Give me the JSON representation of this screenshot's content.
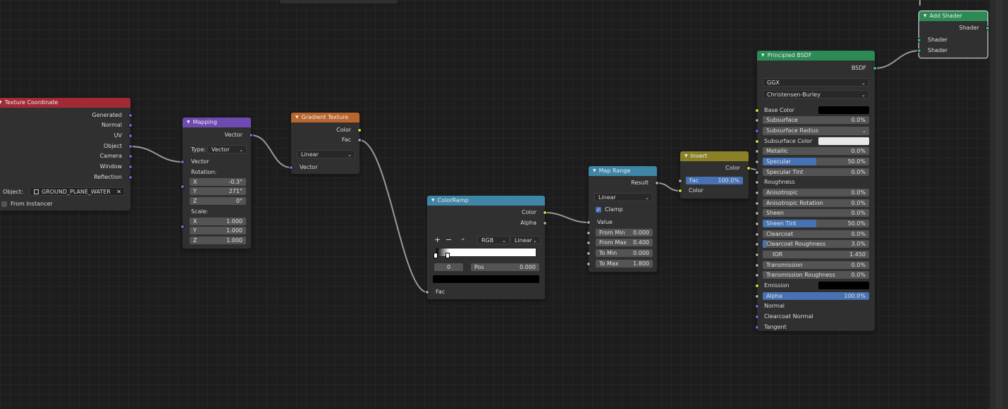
{
  "colors": {
    "texcoord_header": "#a22a35",
    "mapping_header": "#6e4bb0",
    "texture_header": "#b8652e",
    "converter_header": "#3e85a6",
    "color_header": "#8a8127",
    "shader_header": "#2c8a55",
    "vector_socket": "#6c69d2",
    "color_socket": "#d8d83a",
    "float_socket": "#a3a3a3",
    "shader_socket": "#38c06f",
    "value_bar": "#4772b3"
  },
  "texcoord": {
    "title": "Texture Coordinate",
    "outputs": [
      "Generated",
      "Normal",
      "UV",
      "Object",
      "Camera",
      "Window",
      "Reflection"
    ],
    "object_label": "Object:",
    "object_value": "GROUND_PLANE_WATER",
    "from_instancer": "From Instancer",
    "object_icon": "cube-icon",
    "clear_icon": "close-icon"
  },
  "mapping": {
    "title": "Mapping",
    "output": "Vector",
    "type_label": "Type:",
    "type_value": "Vector",
    "vector_label": "Vector",
    "rotation_label": "Rotation:",
    "rotation": [
      {
        "axis": "X",
        "value": "-0.3°"
      },
      {
        "axis": "Y",
        "value": "271°"
      },
      {
        "axis": "Z",
        "value": "0°"
      }
    ],
    "scale_label": "Scale:",
    "scale": [
      {
        "axis": "X",
        "value": "1.000"
      },
      {
        "axis": "Y",
        "value": "1.000"
      },
      {
        "axis": "Z",
        "value": "1.000"
      }
    ]
  },
  "gradient": {
    "title": "Gradient Texture",
    "outputs": [
      "Color",
      "Fac"
    ],
    "type_value": "Linear",
    "input": "Vector"
  },
  "colorramp": {
    "title": "ColorRamp",
    "outputs": [
      "Color",
      "Alpha"
    ],
    "add": "+",
    "remove": "−",
    "menu": "⌄",
    "mode": "RGB",
    "interp": "Linear",
    "index": "0",
    "pos_label": "Pos",
    "pos_value": "0.000",
    "input": "Fac"
  },
  "maprange": {
    "title": "Map Range",
    "output": "Result",
    "interp": "Linear",
    "clamp": "Clamp",
    "clamp_checked": true,
    "value_label": "Value",
    "fields": [
      {
        "label": "From Min",
        "value": "0.000"
      },
      {
        "label": "From Max",
        "value": "0.400"
      },
      {
        "label": "To Min",
        "value": "0.000"
      },
      {
        "label": "To Max",
        "value": "1.800"
      }
    ]
  },
  "invert": {
    "title": "Invert",
    "output": "Color",
    "fac_label": "Fac",
    "fac_value": "100.0%",
    "fac_level": 1.0,
    "color_label": "Color"
  },
  "principled": {
    "title": "Principled BSDF",
    "output": "BSDF",
    "distribution": "GGX",
    "subsurface_method": "Christensen-Burley",
    "base_color": "#000000",
    "subsurface_color": "#e8e8e8",
    "emission": "#000000",
    "rows": [
      {
        "label": "Base Color",
        "kind": "color",
        "socket": "col"
      },
      {
        "label": "Subsurface",
        "value": "0.0%",
        "level": 0,
        "socket": "gry"
      },
      {
        "label": "Subsurface Radius",
        "kind": "dropdown",
        "socket": "vec"
      },
      {
        "label": "Subsurface Color",
        "kind": "color",
        "socket": "col"
      },
      {
        "label": "Metallic",
        "value": "0.0%",
        "level": 0,
        "socket": "gry"
      },
      {
        "label": "Specular",
        "value": "50.0%",
        "level": 0.5,
        "socket": "gry"
      },
      {
        "label": "Specular Tint",
        "value": "0.0%",
        "level": 0,
        "socket": "gry"
      },
      {
        "label": "Roughness",
        "kind": "plain",
        "socket": "gry"
      },
      {
        "label": "Anisotropic",
        "value": "0.0%",
        "level": 0,
        "socket": "gry"
      },
      {
        "label": "Anisotropic Rotation",
        "value": "0.0%",
        "level": 0,
        "socket": "gry"
      },
      {
        "label": "Sheen",
        "value": "0.0%",
        "level": 0,
        "socket": "gry"
      },
      {
        "label": "Sheen Tint",
        "value": "50.0%",
        "level": 0.5,
        "socket": "gry"
      },
      {
        "label": "Clearcoat",
        "value": "0.0%",
        "level": 0,
        "socket": "gry"
      },
      {
        "label": "Clearcoat Roughness",
        "value": "3.0%",
        "level": 0.03,
        "socket": "gry"
      },
      {
        "label": "IOR",
        "value": "1.450",
        "socket": "gry",
        "kind": "number"
      },
      {
        "label": "Transmission",
        "value": "0.0%",
        "level": 0,
        "socket": "gry"
      },
      {
        "label": "Transmission Roughness",
        "value": "0.0%",
        "level": 0,
        "socket": "gry"
      },
      {
        "label": "Emission",
        "kind": "color",
        "socket": "col"
      },
      {
        "label": "Alpha",
        "value": "100.0%",
        "level": 1,
        "socket": "gry"
      },
      {
        "label": "Normal",
        "kind": "plain",
        "socket": "vec"
      },
      {
        "label": "Clearcoat Normal",
        "kind": "plain",
        "socket": "vec"
      },
      {
        "label": "Tangent",
        "kind": "plain",
        "socket": "vec"
      }
    ]
  },
  "addshader": {
    "title": "Add Shader",
    "output": "Shader",
    "inputs": [
      "Shader",
      "Shader"
    ]
  }
}
